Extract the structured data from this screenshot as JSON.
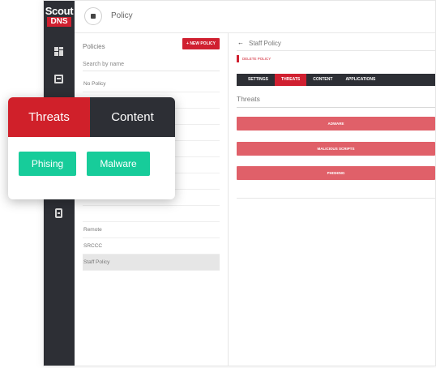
{
  "brand": {
    "line1": "Scout",
    "line2": "DNS"
  },
  "rail": {
    "icons": [
      "dashboard-icon",
      "document-icon",
      "server-icon"
    ]
  },
  "topbar": {
    "title": "Policy"
  },
  "policies": {
    "title": "Policies",
    "new_button": "+ NEW POLICY",
    "search_placeholder": "Search by name",
    "items": [
      {
        "label": "No Policy",
        "selected": false
      },
      {
        "label": "",
        "selected": false
      },
      {
        "label": "",
        "selected": false
      },
      {
        "label": "",
        "selected": false
      },
      {
        "label": "",
        "selected": false
      },
      {
        "label": "",
        "selected": false
      },
      {
        "label": "",
        "selected": false
      },
      {
        "label": "",
        "selected": false
      },
      {
        "label": "",
        "selected": false
      },
      {
        "label": "Remote",
        "selected": false
      },
      {
        "label": "SRCCC",
        "selected": false
      },
      {
        "label": "Staff Policy",
        "selected": true
      }
    ]
  },
  "detail": {
    "back_icon": "arrow-left-icon",
    "title": "Staff Policy",
    "delete_label": "DELETE POLICY",
    "tabs": [
      {
        "label": "SETTINGS",
        "active": false
      },
      {
        "label": "THREATS",
        "active": true
      },
      {
        "label": "CONTENT",
        "active": false
      },
      {
        "label": "APPLICATIONS",
        "active": false
      }
    ],
    "section_label": "Threats",
    "threats": [
      "ADWARE",
      "MALICIOUS SCRIPTS",
      "PHISHING"
    ]
  },
  "card": {
    "tabs": [
      {
        "label": "Threats",
        "active": true
      },
      {
        "label": "Content",
        "active": false
      }
    ],
    "chips": [
      "Phising",
      "Malware"
    ]
  },
  "colors": {
    "brand_red": "#d02030",
    "dark": "#2d2f35",
    "threat_bar": "#e06069",
    "chip_green": "#17cc9a"
  }
}
